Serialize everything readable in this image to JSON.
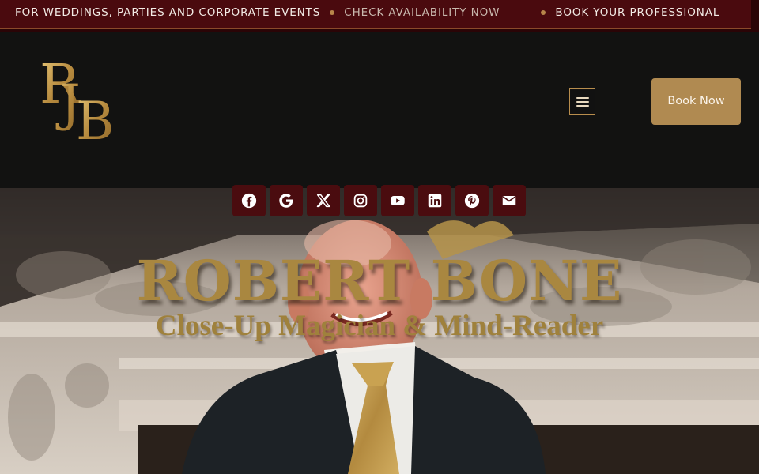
{
  "ticker": {
    "items": [
      {
        "text": "FOR WEDDINGS, PARTIES AND CORPORATE EVENTS",
        "style": "primary"
      },
      {
        "text": "CHECK AVAILABILITY NOW",
        "style": "secondary"
      },
      {
        "text": "BOOK YOUR PROFESSIONAL",
        "style": "primary"
      }
    ]
  },
  "header": {
    "logo": {
      "letters": "RJB",
      "icon": "rjb-monogram-logo"
    },
    "menu": {
      "icon": "hamburger-menu-icon"
    },
    "book_button": "Book Now"
  },
  "social": [
    {
      "name": "facebook",
      "icon": "facebook-icon"
    },
    {
      "name": "google",
      "icon": "google-icon"
    },
    {
      "name": "x",
      "icon": "x-twitter-icon"
    },
    {
      "name": "instagram",
      "icon": "instagram-icon"
    },
    {
      "name": "youtube",
      "icon": "youtube-icon"
    },
    {
      "name": "linkedin",
      "icon": "linkedin-icon"
    },
    {
      "name": "pinterest",
      "icon": "pinterest-icon"
    },
    {
      "name": "email",
      "icon": "envelope-icon"
    }
  ],
  "hero": {
    "title": "ROBERT BONE",
    "subtitle": "Close-Up Magician & Mind-Reader",
    "image": "portrait-photo"
  },
  "colors": {
    "ticker_bg": "#4a0a0e",
    "gold": "#b08a51",
    "header_bg": "#121211",
    "social_bg": "#4a0c0f"
  }
}
